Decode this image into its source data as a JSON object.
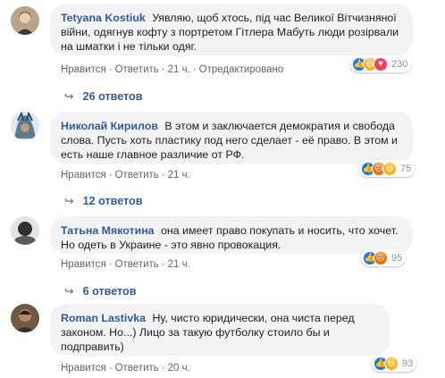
{
  "actions": {
    "like": "Нравится",
    "reply": "Ответить",
    "edited": "Отредактировано"
  },
  "comments": [
    {
      "author": "Tetyana Kostiuk",
      "text": "Уявляю, щоб хтось, під час Великої Вітчизняної війни, одягнув кофту з портретом Гітлера Мабуть люди розірвали на шматки і не тільки одяг.",
      "time": "21 ч.",
      "reaction_count": "230",
      "reactions": [
        "like-icon",
        "haha-icon",
        "love-icon"
      ],
      "replies": "26 ответов",
      "edited": true
    },
    {
      "author": "Николай Кирилов",
      "text": "В этом и заключается демократия и свобода слова. Пусть хоть пластику под него сделает - её право. В этом и есть наше главное различие от РФ.",
      "time": "21 ч.",
      "reaction_count": "75",
      "reactions": [
        "like-icon",
        "angry-icon",
        "haha-icon"
      ],
      "replies": "12 ответов",
      "edited": false
    },
    {
      "author": "Татьна Мякотина",
      "text": "она имеет право покупать и носить, что хочет. Но одеть в Украине - это явно провокация.",
      "time": "21 ч.",
      "reaction_count": "95",
      "reactions": [
        "like-icon",
        "angry-icon"
      ],
      "replies": "6 ответов",
      "edited": false
    },
    {
      "author": "Roman Lastivka",
      "text": "Ну, чисто юридически, она чиста перед законом. Но...) Лицо за такую футболку стоило бы и подправить)",
      "time": "20 ч.",
      "reaction_count": "93",
      "reactions": [
        "like-icon",
        "haha-icon"
      ],
      "replies": "",
      "edited": false
    }
  ]
}
